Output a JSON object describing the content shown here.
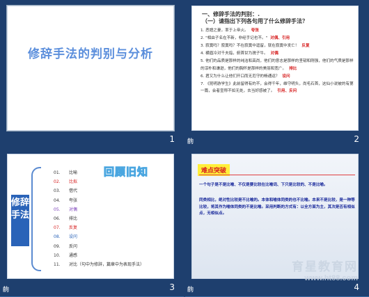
{
  "slides": [
    {
      "number": "1",
      "title": "修辞手法的判别与分析"
    },
    {
      "number": "2",
      "heading1": "一、修辞手法的判别：.",
      "heading2": "（一）请指出下列各句用了什么修辞手法？",
      "items": [
        {
          "text": "1. 恶語之妻，率于上帝火。",
          "answer": "夸张"
        },
        {
          "text": "2. \"相由子名在不新，非经手记也不。\"",
          "answer": "对偶、引用"
        },
        {
          "text": "3. 寂寞吗？寂寞吗？不在寂寞中逗留，就在寂寞中发亡！",
          "answer": "反复"
        },
        {
          "text": "4. 横眉冷对千夫指，俯首甘为孺子牛。",
          "answer": "对偶"
        },
        {
          "text": "5. 他们的品质是那样的纯洁和高尚，他们的意志是那样的坚韧和刚强，他们的气质是那样的淳朴和谦逊，他们的胸怀是那样的美丽和宽广。",
          "answer": "排比"
        },
        {
          "text": "6. 君又为什么让他们开口而无厄守的畅通运？",
          "answer": "设问"
        },
        {
          "text": "7. 《昆明游学生》此前留得有的不，会得千年，维守明头，尚毛石首，这仙小说被的有第一篇，会者宣称不如无处，去当好感被了。",
          "answer": "引用、反问"
        }
      ],
      "transition_icon": "齣"
    },
    {
      "number": "3",
      "side_label": "修辞手法",
      "title": "回顾旧知",
      "items": [
        {
          "num": "01.",
          "label": "比喻",
          "color": "#333333"
        },
        {
          "num": "02.",
          "label": "比拟",
          "color": "#d62020"
        },
        {
          "num": "03.",
          "label": "借代",
          "color": "#333333"
        },
        {
          "num": "04.",
          "label": "夸张",
          "color": "#333333"
        },
        {
          "num": "05.",
          "label": "对偶",
          "color": "#7a3fb8"
        },
        {
          "num": "06.",
          "label": "排比",
          "color": "#333333"
        },
        {
          "num": "07.",
          "label": "反复",
          "color": "#d62020"
        },
        {
          "num": "08.",
          "label": "设问",
          "color": "#2a63b8"
        },
        {
          "num": "09.",
          "label": "反问",
          "color": "#333333"
        },
        {
          "num": "10.",
          "label": "通感",
          "color": "#333333"
        },
        {
          "num": "11.",
          "label": "对比（句中为修辞，篇章中为表现手法）",
          "color": "#333333"
        }
      ],
      "transition_icon": "齣"
    },
    {
      "number": "4",
      "badge": "难点突破",
      "para1": "一个句子是不是比喻、不仅是要比较在比喻词、下只是比较的、不是比喻。",
      "para2": "同类相比，绝对性比较是不比喻的。本体和喻体同类的也不比喻。本来不是比较，是一种等比较，将其作为喻体同类的不是比喻。采用判断的方式有：以全方面为主，其次是否有相似点，无相似点。",
      "watermark_brand": "育星教育网",
      "watermark_url": "www.ht88.com",
      "transition_icon": "齣"
    }
  ]
}
